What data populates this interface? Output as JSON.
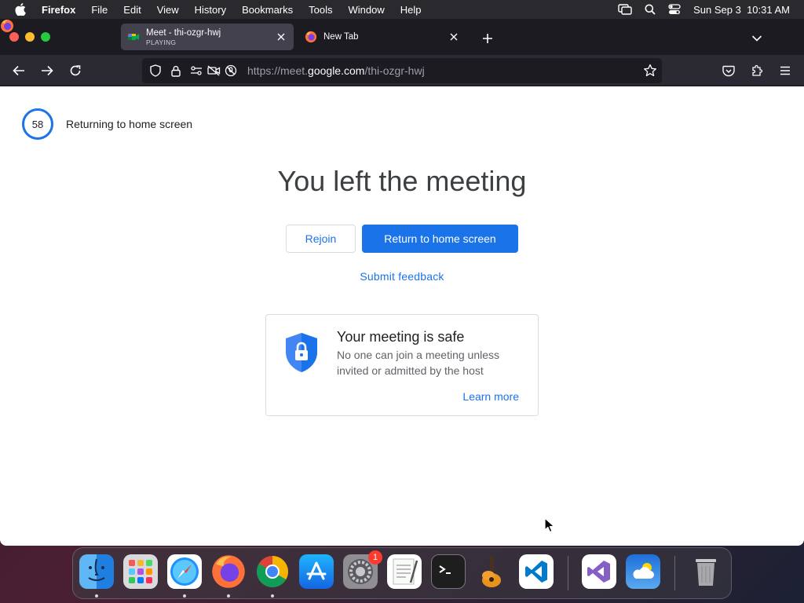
{
  "menubar": {
    "app_name": "Firefox",
    "menus": [
      "File",
      "Edit",
      "View",
      "History",
      "Bookmarks",
      "Tools",
      "Window",
      "Help"
    ],
    "clock": "Sun Sep 3  10:31 AM"
  },
  "browser": {
    "tabs": [
      {
        "title": "Meet - thi-ozgr-hwj",
        "subtitle": "PLAYING",
        "active": true
      },
      {
        "title": "New Tab",
        "subtitle": "",
        "active": false
      }
    ],
    "url": {
      "prefix": "https://meet.",
      "domain": "google.com",
      "path": "/thi-ozgr-hwj"
    }
  },
  "page": {
    "countdown_value": "58",
    "countdown_label": "Returning to home screen",
    "headline": "You left the meeting",
    "rejoin_label": "Rejoin",
    "return_label": "Return to home screen",
    "feedback_label": "Submit feedback",
    "card": {
      "title": "Your meeting is safe",
      "description": "No one can join a meeting unless invited or admitted by the host",
      "learn_more": "Learn more"
    }
  },
  "dock": {
    "badge_count": "1",
    "apps": [
      "finder-icon",
      "launchpad-icon",
      "safari-icon",
      "firefox-icon",
      "chrome-icon",
      "app-store-icon",
      "system-settings-icon",
      "textedit-icon",
      "terminal-icon",
      "garageband-icon",
      "vscode-icon",
      "visual-studio-icon",
      "weather-icon",
      "trash-icon"
    ]
  },
  "colors": {
    "accent": "#1a73e8",
    "menubar": "#2a2a2e",
    "tabstrip": "#1c1b22",
    "navbar": "#2b2a33"
  }
}
